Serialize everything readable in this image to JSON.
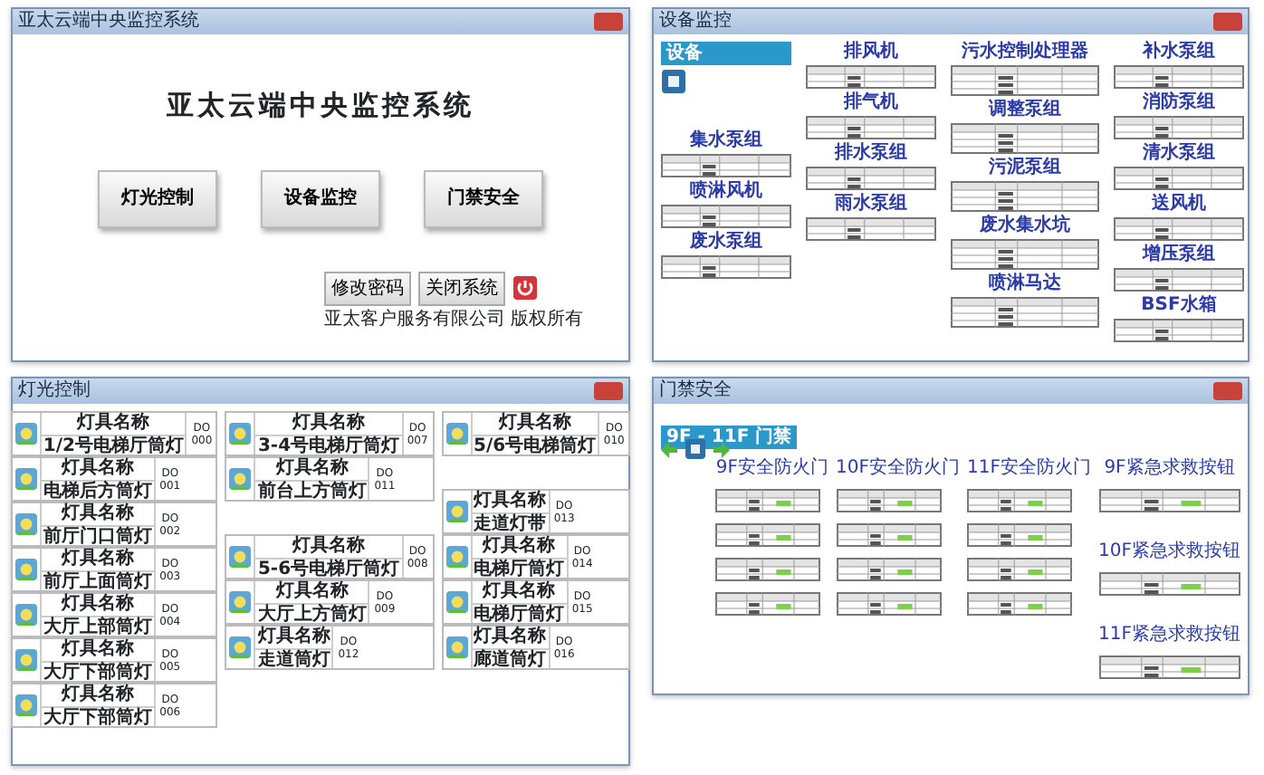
{
  "windows": [
    {
      "kind": "home",
      "title": "亚太云端中央监控系统",
      "heading": "亚太云端中央监控系统",
      "menu_buttons": [
        "灯光控制",
        "设备监控",
        "门禁安全"
      ],
      "small_buttons": [
        "修改密码",
        "关闭系统"
      ],
      "footer": "亚太客户服务有限公司 版权所有"
    },
    {
      "kind": "equipment",
      "title": "设备监控",
      "badge": "设备",
      "columns": [
        [
          "集水泵组",
          "喷淋风机",
          "废水泵组"
        ],
        [
          "排风机",
          "排气机",
          "排水泵组",
          "雨水泵组"
        ],
        [
          "污水控制处理器",
          "调整泵组",
          "污泥泵组",
          "废水集水坑",
          "喷淋马达"
        ],
        [
          "补水泵组",
          "消防泵组",
          "清水泵组",
          "送风机",
          "增压泵组",
          "BSF水箱"
        ]
      ]
    },
    {
      "kind": "lighting",
      "title": "灯光控制",
      "columns": [
        [
          [
            {
              "header": "灯具名称",
              "name": "1/2号电梯厅筒灯",
              "code": "DO 000"
            },
            {
              "header": "灯具名称",
              "name": "电梯后方筒灯",
              "code": "DO 001"
            },
            {
              "header": "灯具名称",
              "name": "前厅门口筒灯",
              "code": "DO 002"
            },
            {
              "header": "灯具名称",
              "name": "前厅上面筒灯",
              "code": "DO 003"
            },
            {
              "header": "灯具名称",
              "name": "大厅上部筒灯",
              "code": "DO 004"
            },
            {
              "header": "灯具名称",
              "name": "大厅下部筒灯",
              "code": "DO 005"
            },
            {
              "header": "灯具名称",
              "name": "大厅下部筒灯",
              "code": "DO 006"
            }
          ]
        ],
        [
          [
            {
              "header": "灯具名称",
              "name": "3-4号电梯厅筒灯",
              "code": "DO 007"
            },
            {
              "header": "灯具名称",
              "name": "前台上方筒灯",
              "code": "DO 011"
            }
          ],
          [
            {
              "header": "灯具名称",
              "name": "5-6号电梯厅筒灯",
              "code": "DO 008"
            },
            {
              "header": "灯具名称",
              "name": "大厅上方筒灯",
              "code": "DO 009"
            },
            {
              "header": "灯具名称",
              "name": "走道筒灯",
              "code": "DO 012"
            }
          ]
        ],
        [
          [
            {
              "header": "灯具名称",
              "name": "5/6号电梯筒灯",
              "code": "DO 010"
            }
          ],
          [
            {
              "header": "灯具名称",
              "name": "走道灯带",
              "code": "DO 013"
            },
            {
              "header": "灯具名称",
              "name": "电梯厅筒灯",
              "code": "DO 014"
            },
            {
              "header": "灯具名称",
              "name": "电梯厅筒灯",
              "code": "DO 015"
            },
            {
              "header": "灯具名称",
              "name": "廊道筒灯",
              "code": "DO 016"
            }
          ]
        ]
      ]
    },
    {
      "kind": "access",
      "title": "门禁安全",
      "badge": "9F - 11F 门禁",
      "columns": [
        [
          {
            "title": "9F安全防火门",
            "kind": "door"
          }
        ],
        [
          {
            "title": "10F安全防火门",
            "kind": "door"
          }
        ],
        [
          {
            "title": "11F安全防火门",
            "kind": "door"
          }
        ],
        [
          {
            "title": "9F紧急求救按钮",
            "kind": "alarm"
          },
          {
            "title": "10F紧急求救按钮",
            "kind": "alarm"
          },
          {
            "title": "11F紧急求救按钮",
            "kind": "alarm"
          }
        ]
      ]
    }
  ]
}
